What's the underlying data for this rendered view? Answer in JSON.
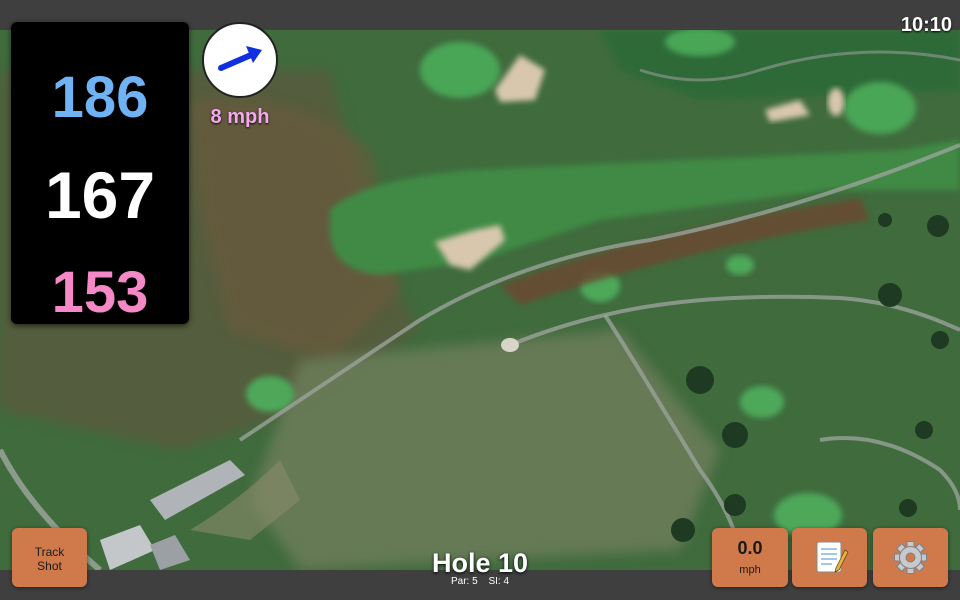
{
  "status": {
    "time": "10:10"
  },
  "distances": {
    "back": "186",
    "middle": "167",
    "front": "153"
  },
  "wind": {
    "speed": "8 mph",
    "icon": "wind-direction-arrow-icon"
  },
  "buttons": {
    "track_shot_line1": "Track",
    "track_shot_line2": "Shot",
    "speed_value": "0.0",
    "speed_unit": "mph",
    "notes_icon": "scorecard-notes-icon",
    "settings_icon": "gear-icon"
  },
  "hole": {
    "title": "Hole 10",
    "par": "Par: 5",
    "si": "SI: 4"
  },
  "colors": {
    "back_distance": "#6fb3f5",
    "middle_distance": "#ffffff",
    "front_distance": "#f589c8",
    "wind_speed": "#f4a8ef",
    "button_bg": "#d07a4c",
    "arrow": "#1030e0"
  }
}
